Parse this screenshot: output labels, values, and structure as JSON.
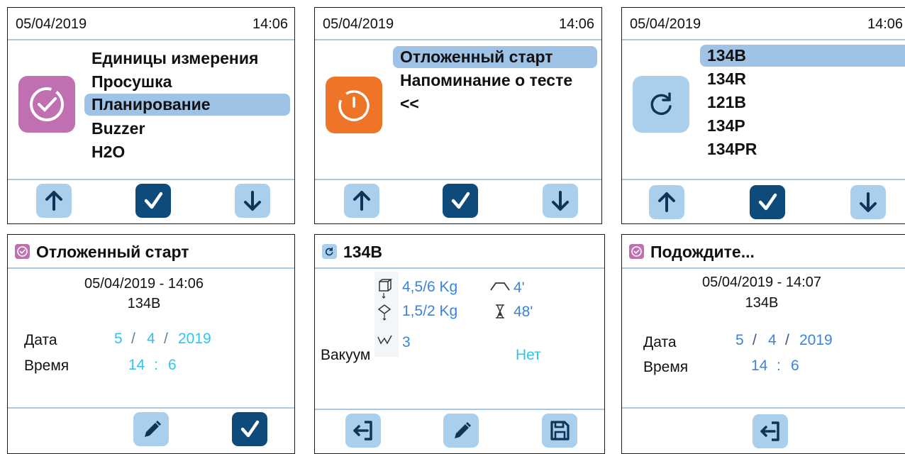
{
  "screen1": {
    "date": "05/04/2019",
    "time": "14:06",
    "icon": "clock-check-icon",
    "icon_color": "#c06fb0",
    "menu": [
      "Единицы измерения",
      "Просушка",
      "Планирование",
      "Buzzer",
      "H2O"
    ],
    "selected_index": 2,
    "buttons": [
      "arrow-up-icon",
      "check-icon",
      "arrow-down-icon"
    ]
  },
  "screen2": {
    "date": "05/04/2019",
    "time": "14:06",
    "icon": "power-icon",
    "icon_color": "#ee7427",
    "menu": [
      "Отложенный старт",
      "Напоминание о тесте",
      "<<"
    ],
    "selected_index": 0,
    "buttons": [
      "arrow-up-icon",
      "check-icon",
      "arrow-down-icon"
    ]
  },
  "screen3": {
    "date": "05/04/2019",
    "time": "14:06",
    "icon": "refresh-icon",
    "icon_color": "#a9cfed",
    "menu": [
      "134B",
      "134R",
      "121B",
      "134P",
      "134PR"
    ],
    "selected_index": 0,
    "buttons": [
      "arrow-up-icon",
      "check-icon",
      "arrow-down-icon"
    ]
  },
  "screen4": {
    "title": "Отложенный старт",
    "title_icon": "clock-check-icon",
    "datetime": "05/04/2019 - 14:06",
    "program": "134B",
    "date_label": "Дата",
    "date_day": "5",
    "date_sep1": "/",
    "date_month": "4",
    "date_sep2": "/",
    "date_year": "2019",
    "time_label": "Время",
    "time_hour": "14",
    "time_sep": ":",
    "time_min": "6",
    "buttons": [
      "pencil-icon",
      "check-icon"
    ]
  },
  "screen5": {
    "title": "134B",
    "title_icon": "refresh-icon",
    "load_solid": "4,5/6 Kg",
    "load_porous": "1,5/2 Kg",
    "vacuum_pulses": "3",
    "sterilization_time": "4'",
    "total_time": "48'",
    "vacuum_label": "Вакуум",
    "vacuum_value": "Нет",
    "buttons": [
      "back-icon",
      "pencil-icon",
      "save-icon"
    ]
  },
  "screen6": {
    "title": "Подождите...",
    "title_icon": "clock-check-icon",
    "datetime": "05/04/2019 - 14:07",
    "program": "134B",
    "date_label": "Дата",
    "date_day": "5",
    "date_sep1": "/",
    "date_month": "4",
    "date_sep2": "/",
    "date_year": "2019",
    "time_label": "Время",
    "time_hour": "14",
    "time_sep": ":",
    "time_min": "6",
    "buttons": [
      "back-icon"
    ]
  },
  "colors": {
    "selection": "#9ec3e6",
    "button_light": "#a9cfed",
    "button_dark": "#0e4a7a",
    "value_cyan": "#2fc4ee",
    "value_blue": "#3b84d8",
    "divider": "#a9c8e3"
  }
}
